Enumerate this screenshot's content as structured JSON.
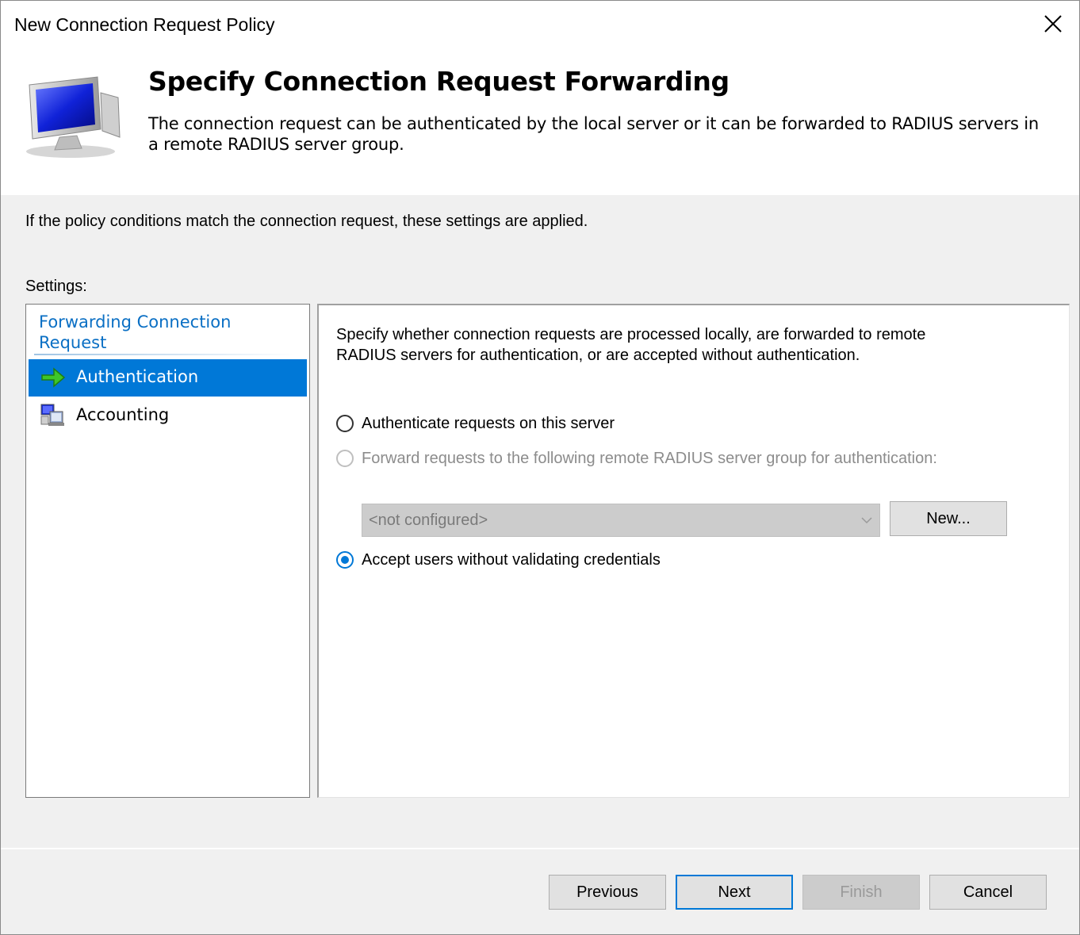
{
  "window": {
    "title": "New Connection Request Policy"
  },
  "header": {
    "title": "Specify Connection Request Forwarding",
    "description": "The connection request can be authenticated by the local server or it can be forwarded to RADIUS servers in a remote RADIUS server group.",
    "icon": "computer-monitor-icon"
  },
  "intro_text": "If the policy conditions match the connection request, these settings are applied.",
  "settings_label": "Settings:",
  "nav": {
    "group_heading": "Forwarding Connection Request",
    "items": [
      {
        "label": "Authentication",
        "icon": "green-arrow-icon",
        "selected": true
      },
      {
        "label": "Accounting",
        "icon": "accounting-computers-icon",
        "selected": false
      }
    ]
  },
  "panel": {
    "description": "Specify whether connection requests are processed locally, are forwarded to remote RADIUS servers for authentication, or are accepted without authentication.",
    "options": [
      {
        "label": "Authenticate requests on this server",
        "checked": false,
        "enabled": true
      },
      {
        "label": "Forward requests to the following remote RADIUS server group for authentication:",
        "checked": false,
        "enabled": false
      },
      {
        "label": "Accept users without validating credentials",
        "checked": true,
        "enabled": true
      }
    ],
    "server_group_value": "<not configured>",
    "new_button": "New..."
  },
  "buttons": {
    "previous": "Previous",
    "next": "Next",
    "finish": "Finish",
    "cancel": "Cancel"
  },
  "colors": {
    "accent": "#0078d7",
    "heading_blue": "#0a6fc4",
    "window_bg": "#f0f0f0"
  }
}
